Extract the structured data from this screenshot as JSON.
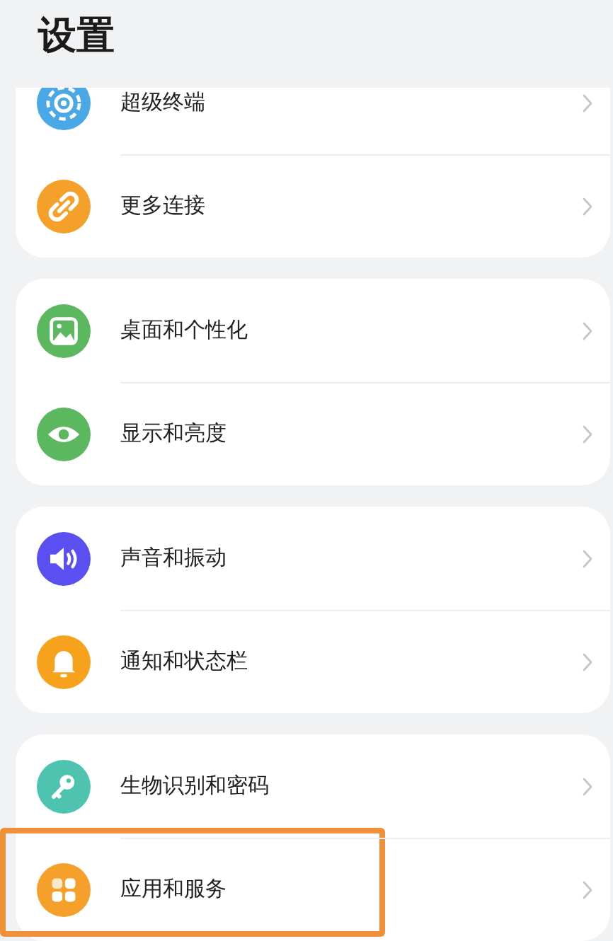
{
  "title": "设置",
  "groups": [
    {
      "items": [
        {
          "kind": "radar",
          "color": "#4aa8e6",
          "label": "超级终端",
          "highlighted": false
        },
        {
          "kind": "link",
          "color": "#f5a02a",
          "label": "更多连接",
          "highlighted": false
        }
      ]
    },
    {
      "items": [
        {
          "kind": "image",
          "color": "#5cb85e",
          "label": "桌面和个性化",
          "highlighted": false
        },
        {
          "kind": "eye",
          "color": "#5cb85e",
          "label": "显示和亮度",
          "highlighted": false
        }
      ]
    },
    {
      "items": [
        {
          "kind": "speaker",
          "color": "#5a4ff0",
          "label": "声音和振动",
          "highlighted": false
        },
        {
          "kind": "bell",
          "color": "#f7a21d",
          "label": "通知和状态栏",
          "highlighted": false
        }
      ]
    },
    {
      "items": [
        {
          "kind": "key",
          "color": "#4ec4b0",
          "label": "生物识别和密码",
          "highlighted": false
        },
        {
          "kind": "grid",
          "color": "#f5a02a",
          "label": "应用和服务",
          "highlighted": true
        }
      ]
    }
  ]
}
